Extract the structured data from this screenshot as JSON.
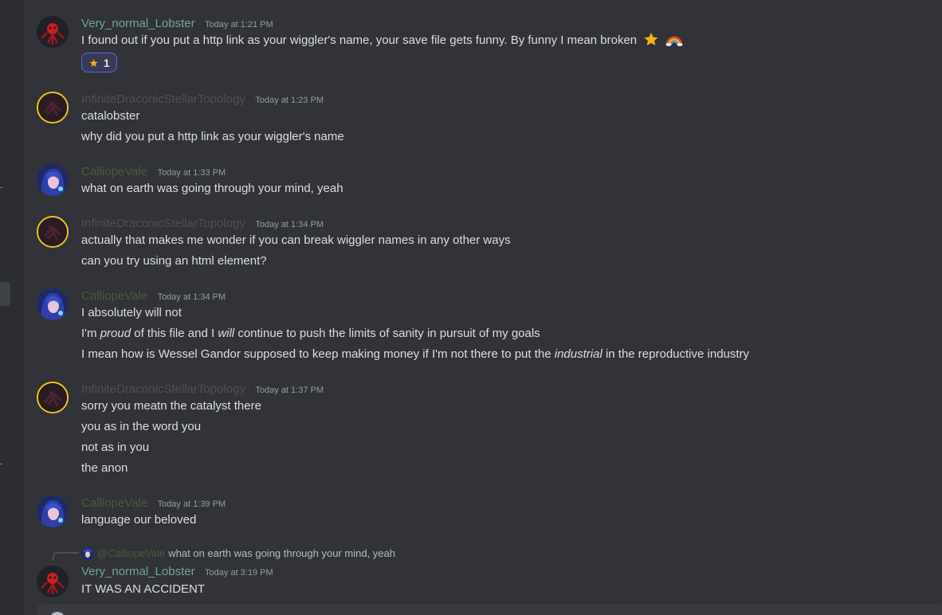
{
  "messages": [
    {
      "author": "Very_normal_Lobster",
      "timestamp": "Today at 1:21 PM",
      "lines": [
        "I found out if you put a http link as your wiggler's name, your save file gets funny. By funny I mean broken"
      ],
      "reaction": {
        "emoji": "star-icon",
        "count": "1"
      }
    },
    {
      "author": "InfiniteDraconicStellarTopology",
      "timestamp": "Today at 1:23 PM",
      "lines": [
        "catalobster",
        "why did you put a http link as your wiggler's name"
      ]
    },
    {
      "author": "CalliopeVale",
      "timestamp": "Today at 1:33 PM",
      "lines": [
        "what on earth was going through your mind, yeah"
      ]
    },
    {
      "author": "InfiniteDraconicStellarTopology",
      "timestamp": "Today at 1:34 PM",
      "lines": [
        "actually that makes me wonder if you can break wiggler names in any other ways",
        "can you try using an html element?"
      ]
    },
    {
      "author": "CalliopeVale",
      "timestamp": "Today at 1:34 PM",
      "lines": [
        "I absolutely will not",
        {
          "a": "I'm ",
          "b": "proud",
          "c": " of this file and I ",
          "d": "will",
          "e": " continue to push the limits of sanity in pursuit of my goals"
        },
        {
          "a": "I mean how is Wessel Gandor supposed to keep making money if I'm not there to put the ",
          "b": "industrial",
          "c": " in the reproductive industry"
        }
      ]
    },
    {
      "author": "InfiniteDraconicStellarTopology",
      "timestamp": "Today at 1:37 PM",
      "lines": [
        "sorry you meatn the catalyst there",
        "you as in the word you",
        "not as in you",
        "the anon"
      ]
    },
    {
      "author": "CalliopeVale",
      "timestamp": "Today at 1:39 PM",
      "lines": [
        "language our beloved"
      ]
    },
    {
      "author": "Very_normal_Lobster",
      "timestamp": "Today at 3:19 PM",
      "reply_to": {
        "mention": "@CalliopeVale",
        "text": "what on earth was going through your mind, yeah"
      },
      "lines": [
        "IT WAS AN ACCIDENT"
      ]
    }
  ],
  "colors": {
    "background": "#313338",
    "lobster_name": "#6fa690",
    "idst_name": "#4e5057",
    "calliope_name": "#4c5a3c",
    "reaction_border": "#5865f2"
  }
}
